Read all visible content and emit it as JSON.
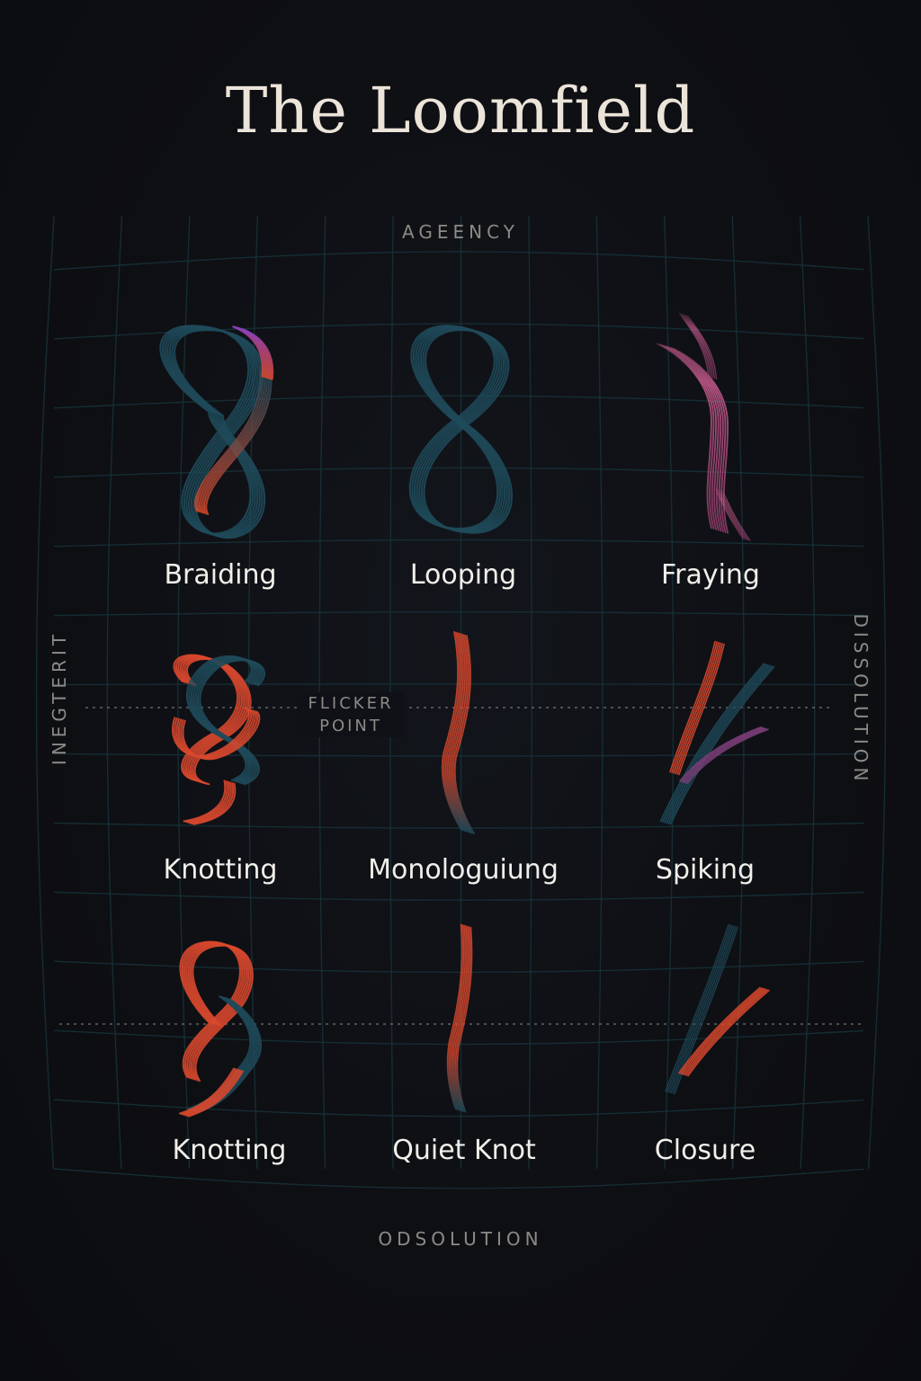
{
  "title": "The Loomfield",
  "axes": {
    "top": "AGEENCY",
    "bottom": "ODSOLUTION",
    "left": "INEGTERIT",
    "right": "DISSOLUTION"
  },
  "flicker_point": {
    "line1": "FLICKER",
    "line2": "POINT"
  },
  "cells": [
    {
      "label": "Braiding",
      "glyph": "braided-figure-eight-icon"
    },
    {
      "label": "Looping",
      "glyph": "figure-eight-loop-icon"
    },
    {
      "label": "Fraying",
      "glyph": "frayed-strand-icon"
    },
    {
      "label": "Knotting",
      "glyph": "pretzel-knot-icon"
    },
    {
      "label": "Monologuiung",
      "glyph": "single-strand-icon"
    },
    {
      "label": "Spiking",
      "glyph": "spike-strands-icon"
    },
    {
      "label": "Knotting",
      "glyph": "loose-knot-icon"
    },
    {
      "label": "Quiet Knot",
      "glyph": "quiet-strand-icon"
    },
    {
      "label": "Closure",
      "glyph": "closing-strands-icon"
    }
  ],
  "colors": {
    "background": "#0e0f13",
    "grid": "#16323a",
    "teal_strand": "#1f4a5a",
    "red_strand": "#d8482d",
    "pink_strand": "#c95c8f",
    "purple_strand": "#8a3fb8",
    "title": "#ece4d9",
    "axis_text": "#8c8a86"
  }
}
